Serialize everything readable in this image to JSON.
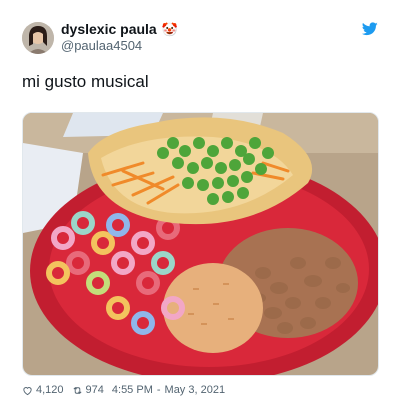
{
  "user": {
    "display_name": "dyslexic paula",
    "badge_emoji": "🤡",
    "handle": "@paulaa4504",
    "avatar_icon": "profile-photo"
  },
  "tweet": {
    "text": "mi gusto musical",
    "media_description_icon": "food-plate-photo"
  },
  "metrics": {
    "likes": "4,120",
    "retweets": "974",
    "time": "4:55 PM",
    "date": "May 3, 2021"
  },
  "colors": {
    "brand": "#1d9bf0",
    "secondary_text": "#536471",
    "plate": "#d9283a"
  }
}
